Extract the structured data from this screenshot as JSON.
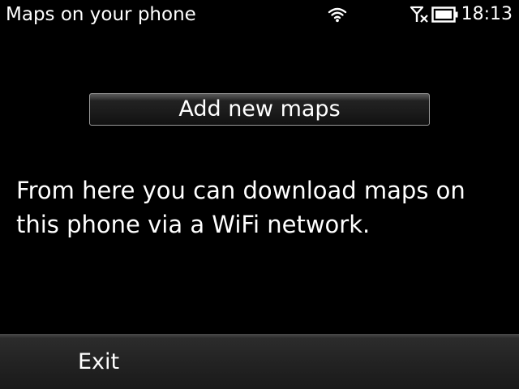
{
  "status_bar": {
    "title": "Maps on your phone",
    "time": "18:13",
    "icons": {
      "wifi": "wifi-icon",
      "signal": "no-signal-icon",
      "battery": "battery-icon"
    }
  },
  "main": {
    "add_maps_button_label": "Add new maps",
    "info_text": "From here you can download maps on this phone via a WiFi network."
  },
  "softkeys": {
    "left_label": "Exit"
  },
  "colors": {
    "background": "#000000",
    "text": "#ffffff",
    "button_border": "#9a9a9a",
    "softkey_bar": "#232323"
  }
}
